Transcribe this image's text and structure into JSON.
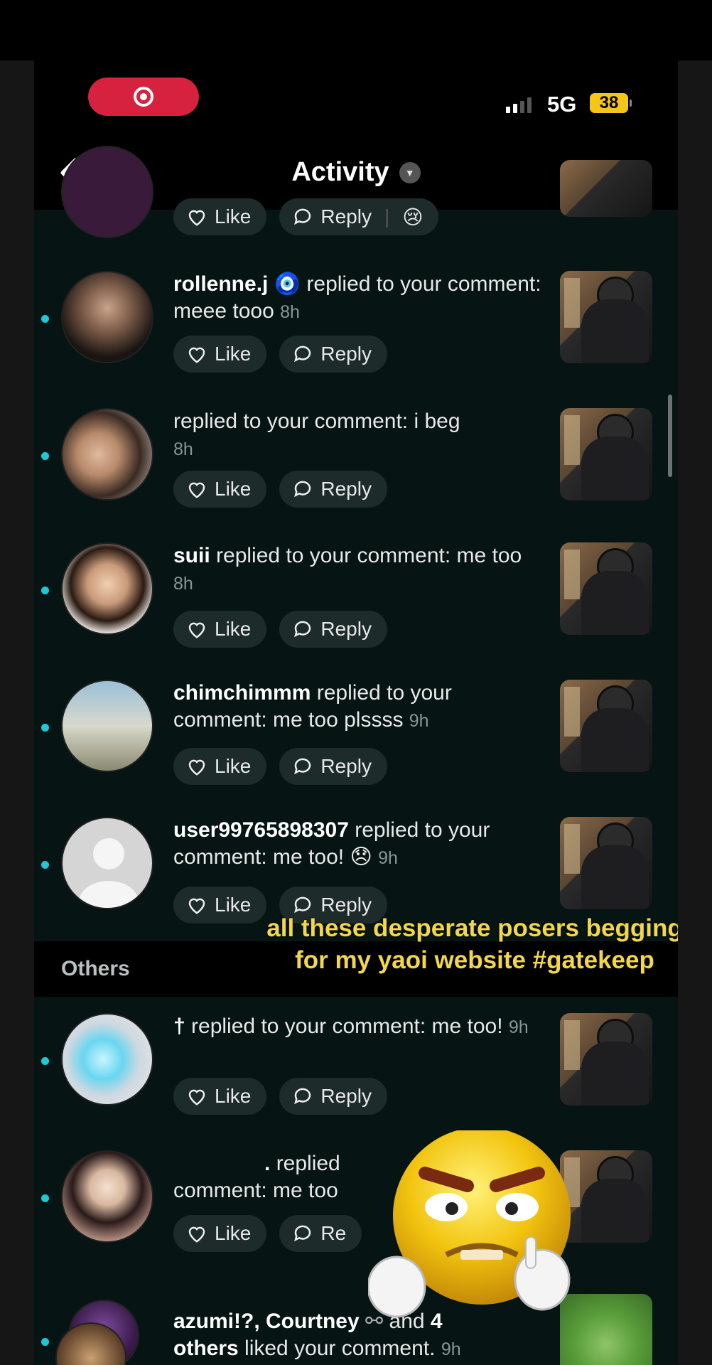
{
  "status_bar": {
    "network": "5G",
    "battery": "38"
  },
  "header": {
    "title": "Activity"
  },
  "top_partial": {
    "like": "Like",
    "reply": "Reply"
  },
  "rows": [
    {
      "username": "rollenne.j",
      "emoji_after_name": "🧿",
      "action": "replied to your comment: meee tooo",
      "time": "8h",
      "like": "Like",
      "reply": "Reply"
    },
    {
      "username": "",
      "action": "replied to your comment: i beg",
      "time": "8h",
      "like": "Like",
      "reply": "Reply"
    },
    {
      "username": "suii",
      "action": "replied to your comment: me too",
      "time": "8h",
      "like": "Like",
      "reply": "Reply"
    },
    {
      "username": "chimchimmm",
      "action": "replied to your comment: me too plssss",
      "time": "9h",
      "like": "Like",
      "reply": "Reply"
    },
    {
      "username": "user99765898307",
      "action": "replied to your comment: me too!",
      "time": "9h",
      "like": "Like",
      "reply": "Reply"
    }
  ],
  "section_others": "Others",
  "others_rows": [
    {
      "username": "†",
      "action": "replied to your comment: me too!",
      "time": "9h",
      "like": "Like",
      "reply": "Reply"
    },
    {
      "username": ".",
      "action": "replied",
      "action2": "comment: me too",
      "like": "Like",
      "reply": "Re"
    },
    {
      "names": "azumi!?, Courtney",
      "and_text": "and",
      "count": "4",
      "others_word": "others",
      "liked": "liked your comment.",
      "time": "9h"
    }
  ],
  "overlay_caption": "all these desperate posers begging for my yaoi website #gatekeep",
  "colors": {
    "unread_dot": "#1fc8d6",
    "caption": "#f2d64b",
    "record": "#d6213f"
  }
}
